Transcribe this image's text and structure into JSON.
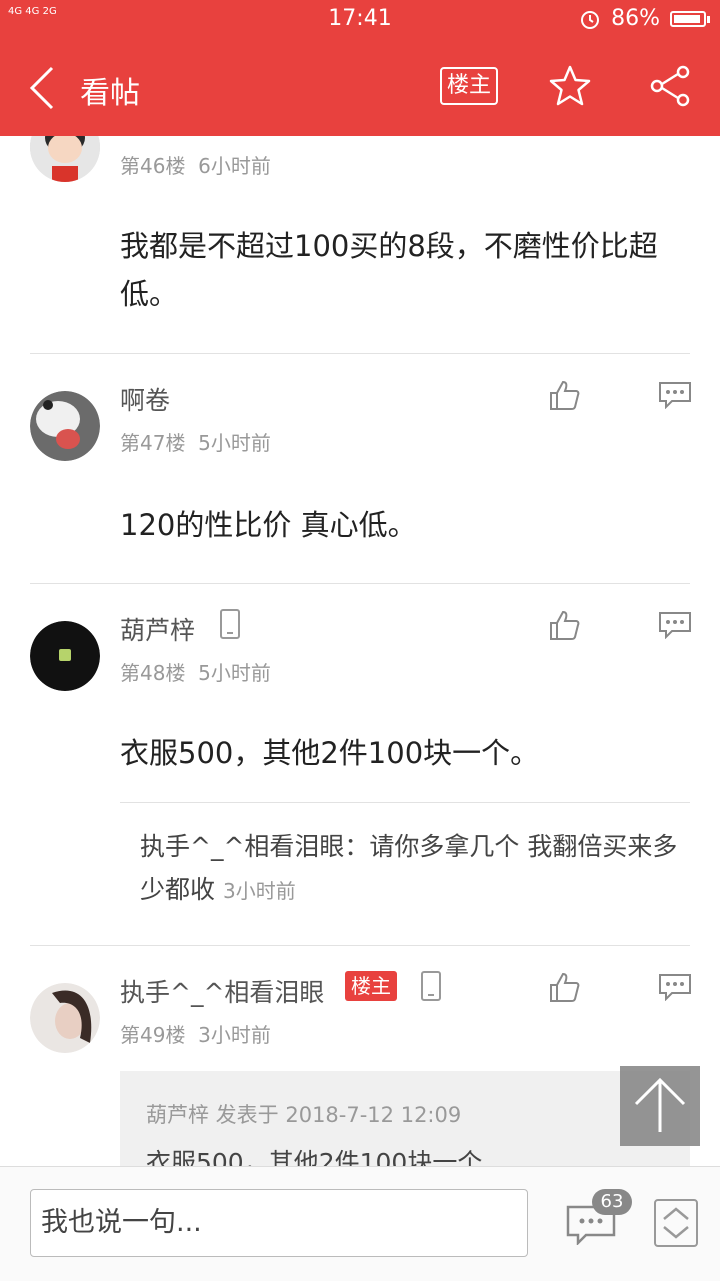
{
  "status_bar": {
    "network": "4G 4G 2G",
    "time": "17:41",
    "battery": "86%"
  },
  "header": {
    "title": "看帖",
    "louzhu_button": "楼主"
  },
  "posts": [
    {
      "floor": "第46楼",
      "time": "6小时前",
      "content": "我都是不超过100买的8段，不磨性价比超低。"
    },
    {
      "username": "啊卷",
      "floor": "第47楼",
      "time": "5小时前",
      "content": "120的性比价 真心低。"
    },
    {
      "username": "葫芦梓",
      "floor": "第48楼",
      "time": "5小时前",
      "content": "衣服500，其他2件100块一个。",
      "reply": {
        "text": "执手^_^相看泪眼：请你多拿几个 我翻倍买来多少都收",
        "time": "3小时前"
      }
    },
    {
      "username": "执手^_^相看泪眼",
      "badge": "楼主",
      "floor": "第49楼",
      "time": "3小时前",
      "quote": {
        "header": "葫芦梓 发表于 2018-7-12 12:09",
        "body": "衣服500，其他2件100块一个"
      }
    }
  ],
  "bottom_bar": {
    "input_placeholder": "我也说一句...",
    "comment_count": "63"
  }
}
